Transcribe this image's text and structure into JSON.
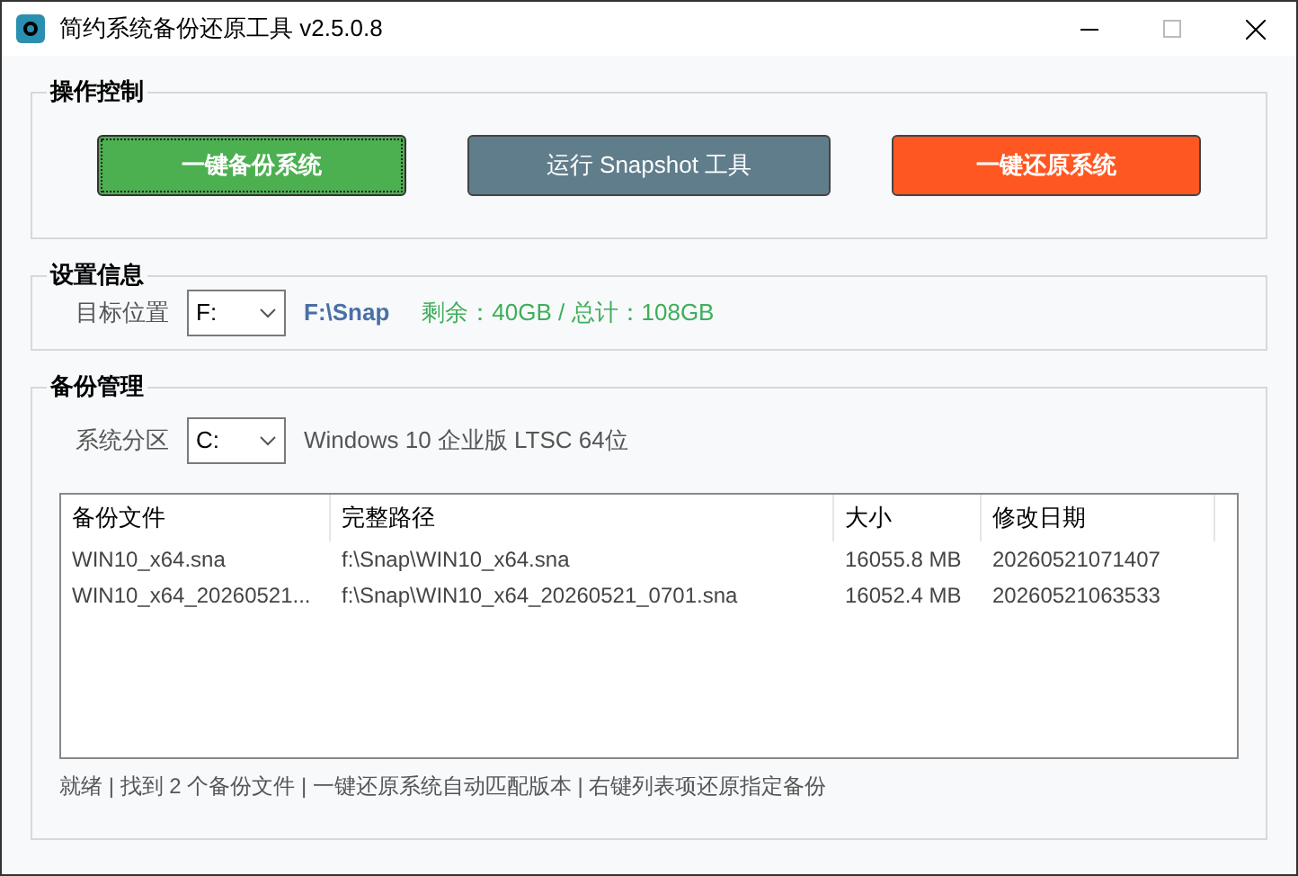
{
  "window": {
    "title": "简约系统备份还原工具 v2.5.0.8"
  },
  "controls": {
    "title": "操作控制",
    "buttons": [
      {
        "label": "一键备份系统",
        "color": "#4caf50",
        "bold": true,
        "focused": true
      },
      {
        "label": "运行 Snapshot 工具",
        "color": "#607d8b",
        "bold": false,
        "focused": false
      },
      {
        "label": "一键还原系统",
        "color": "#ff5722",
        "bold": true,
        "focused": false
      }
    ]
  },
  "settings": {
    "title": "设置信息",
    "label": "目标位置",
    "drive": "F:",
    "path": "F:\\Snap",
    "space": "剩余：40GB / 总计：108GB"
  },
  "backup": {
    "title": "备份管理",
    "label": "系统分区",
    "drive": "C:",
    "os": "Windows 10 企业版 LTSC 64位",
    "table": {
      "columns": [
        "备份文件",
        "完整路径",
        "大小",
        "修改日期"
      ],
      "rows": [
        [
          "WIN10_x64.sna",
          "f:\\Snap\\WIN10_x64.sna",
          "16055.8 MB",
          "20260521071407"
        ],
        [
          "WIN10_x64_20260521...",
          "f:\\Snap\\WIN10_x64_20260521_0701.sna",
          "16052.4 MB",
          "20260521063533"
        ]
      ]
    }
  },
  "status_bar": "就绪 | 找到 2 个备份文件 | 一键还原系统自动匹配版本 | 右键列表项还原指定备份"
}
